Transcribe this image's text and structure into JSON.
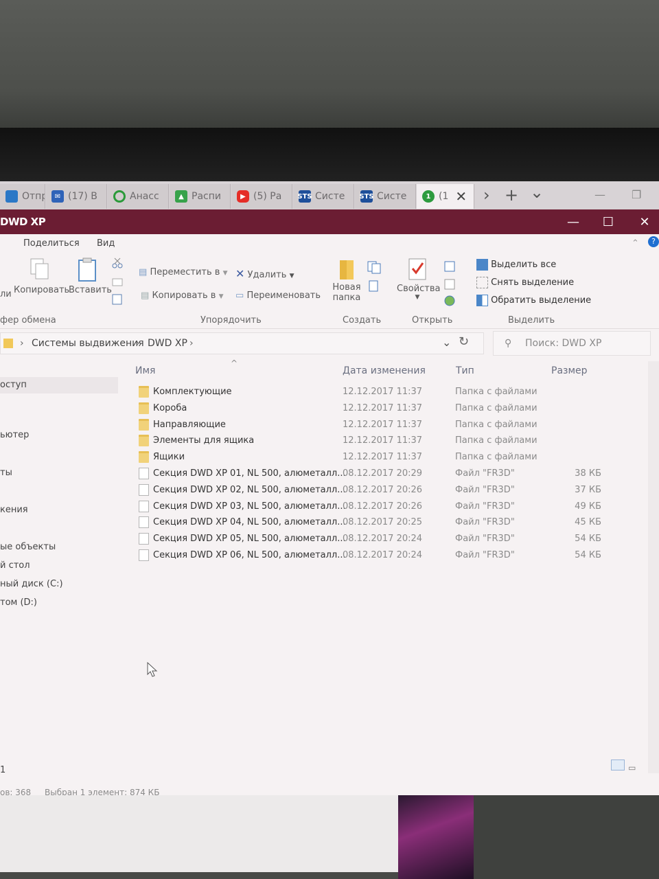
{
  "browser": {
    "tabs": [
      {
        "label": "Отпра",
        "icon": "blue-app-icon",
        "color": "#2b78c6"
      },
      {
        "label": "(17) В",
        "icon": "mail-icon",
        "color": "#2f63b8"
      },
      {
        "label": "Анасс",
        "icon": "green-circle-icon",
        "color": "#2b9a3a"
      },
      {
        "label": "Распи",
        "icon": "mountain-image-icon",
        "color": "#37a24a"
      },
      {
        "label": "(5) Ра",
        "icon": "youtube-icon",
        "color": "#e52d27"
      },
      {
        "label": "Систе",
        "icon": "sts-icon",
        "color": "#1e4f9a",
        "glyph": "STS"
      },
      {
        "label": "Систе",
        "icon": "sts-icon",
        "color": "#1e4f9a",
        "glyph": "STS"
      },
      {
        "label": "(1",
        "icon": "badge-icon",
        "color": "#2d9b3f",
        "glyph": "1"
      }
    ],
    "new_tab": "+",
    "forward": "›",
    "tab_list": "⌄"
  },
  "window": {
    "title": "DWD XP",
    "minimize": "—",
    "maximize": "☐",
    "close": "✕"
  },
  "ribbon": {
    "tabs": [
      "Поделиться",
      "Вид"
    ],
    "clipboard": {
      "partial_label": "ли",
      "copy": "Копировать",
      "paste": "Вставить",
      "group": "фер обмена"
    },
    "organize": {
      "move_to": "Переместить в",
      "copy_to": "Копировать в",
      "delete": "Удалить",
      "rename": "Переименовать",
      "group": "Упорядочить"
    },
    "create": {
      "new_folder_line1": "Новая",
      "new_folder_line2": "папка",
      "group": "Создать"
    },
    "open": {
      "properties": "Свойства",
      "group": "Открыть"
    },
    "select": {
      "select_all": "Выделить все",
      "select_none": "Снять выделение",
      "invert": "Обратить выделение",
      "group": "Выделить"
    }
  },
  "address": {
    "crumbs": [
      "Системы выдвижения",
      "DWD XP"
    ],
    "separator": "›",
    "search_placeholder": "Поиск: DWD XP"
  },
  "nav": {
    "items": [
      {
        "label": "оступ",
        "selected": true
      },
      {
        "label": "ьютер"
      },
      {
        "label": "ты"
      },
      {
        "label": "кения"
      },
      {
        "label": "ые объекты"
      },
      {
        "label": "й стол"
      },
      {
        "label": "ный диск (C:)"
      },
      {
        "label": "том (D:)"
      },
      {
        "label": "1"
      }
    ]
  },
  "columns": {
    "name": "Имя",
    "date": "Дата изменения",
    "type": "Тип",
    "size": "Размер"
  },
  "files": [
    {
      "name": "Комплектующие",
      "date": "12.12.2017 11:37",
      "type": "Папка с файлами",
      "size": "",
      "kind": "folder"
    },
    {
      "name": "Короба",
      "date": "12.12.2017 11:37",
      "type": "Папка с файлами",
      "size": "",
      "kind": "folder"
    },
    {
      "name": "Направляющие",
      "date": "12.12.2017 11:37",
      "type": "Папка с файлами",
      "size": "",
      "kind": "folder"
    },
    {
      "name": "Элементы для ящика",
      "date": "12.12.2017 11:37",
      "type": "Папка с файлами",
      "size": "",
      "kind": "folder"
    },
    {
      "name": "Ящики",
      "date": "12.12.2017 11:37",
      "type": "Папка с файлами",
      "size": "",
      "kind": "folder"
    },
    {
      "name": "Секция DWD XP 01, NL 500, алюметалл...",
      "date": "08.12.2017 20:29",
      "type": "Файл \"FR3D\"",
      "size": "38 КБ",
      "kind": "file"
    },
    {
      "name": "Секция DWD XP 02, NL 500, алюметалл...",
      "date": "08.12.2017 20:26",
      "type": "Файл \"FR3D\"",
      "size": "37 КБ",
      "kind": "file"
    },
    {
      "name": "Секция DWD XP 03, NL 500, алюметалл...",
      "date": "08.12.2017 20:26",
      "type": "Файл \"FR3D\"",
      "size": "49 КБ",
      "kind": "file"
    },
    {
      "name": "Секция DWD XP 04, NL 500, алюметалл...",
      "date": "08.12.2017 20:25",
      "type": "Файл \"FR3D\"",
      "size": "45 КБ",
      "kind": "file"
    },
    {
      "name": "Секция DWD XP 05, NL 500, алюметалл...",
      "date": "08.12.2017 20:24",
      "type": "Файл \"FR3D\"",
      "size": "54 КБ",
      "kind": "file"
    },
    {
      "name": "Секция DWD XP 06, NL 500, алюметалл...",
      "date": "08.12.2017 20:24",
      "type": "Файл \"FR3D\"",
      "size": "54 КБ",
      "kind": "file"
    }
  ],
  "status": {
    "count": "ов: 368",
    "selected": "Выбран 1 элемент: 874 КБ"
  }
}
